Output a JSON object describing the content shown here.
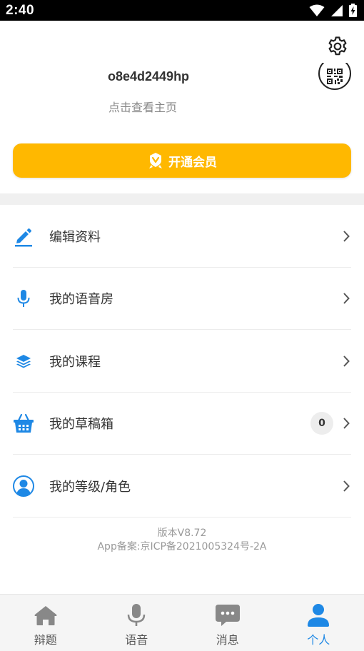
{
  "status_bar": {
    "time": "2:40"
  },
  "profile": {
    "username": "o8e4d2449hp",
    "profile_link": "点击查看主页"
  },
  "vip": {
    "label": "开通会员",
    "color": "#FFB800"
  },
  "menu": {
    "items": [
      {
        "label": "编辑资料",
        "icon": "pencil-icon"
      },
      {
        "label": "我的语音房",
        "icon": "microphone-icon"
      },
      {
        "label": "我的课程",
        "icon": "layers-icon"
      },
      {
        "label": "我的草稿箱",
        "icon": "basket-icon",
        "badge": "0"
      },
      {
        "label": "我的等级/角色",
        "icon": "user-circle-icon"
      }
    ]
  },
  "footer": {
    "version": "版本V8.72",
    "icp": "App备案:京ICP备2021005324号-2A"
  },
  "tabs": [
    {
      "label": "辩题",
      "icon": "home-icon",
      "active": false
    },
    {
      "label": "语音",
      "icon": "microphone-icon",
      "active": false
    },
    {
      "label": "消息",
      "icon": "chat-icon",
      "active": false
    },
    {
      "label": "个人",
      "icon": "person-icon",
      "active": true
    }
  ],
  "colors": {
    "accent": "#1E88E5",
    "vip": "#FFB800",
    "tab_inactive": "#888888"
  }
}
